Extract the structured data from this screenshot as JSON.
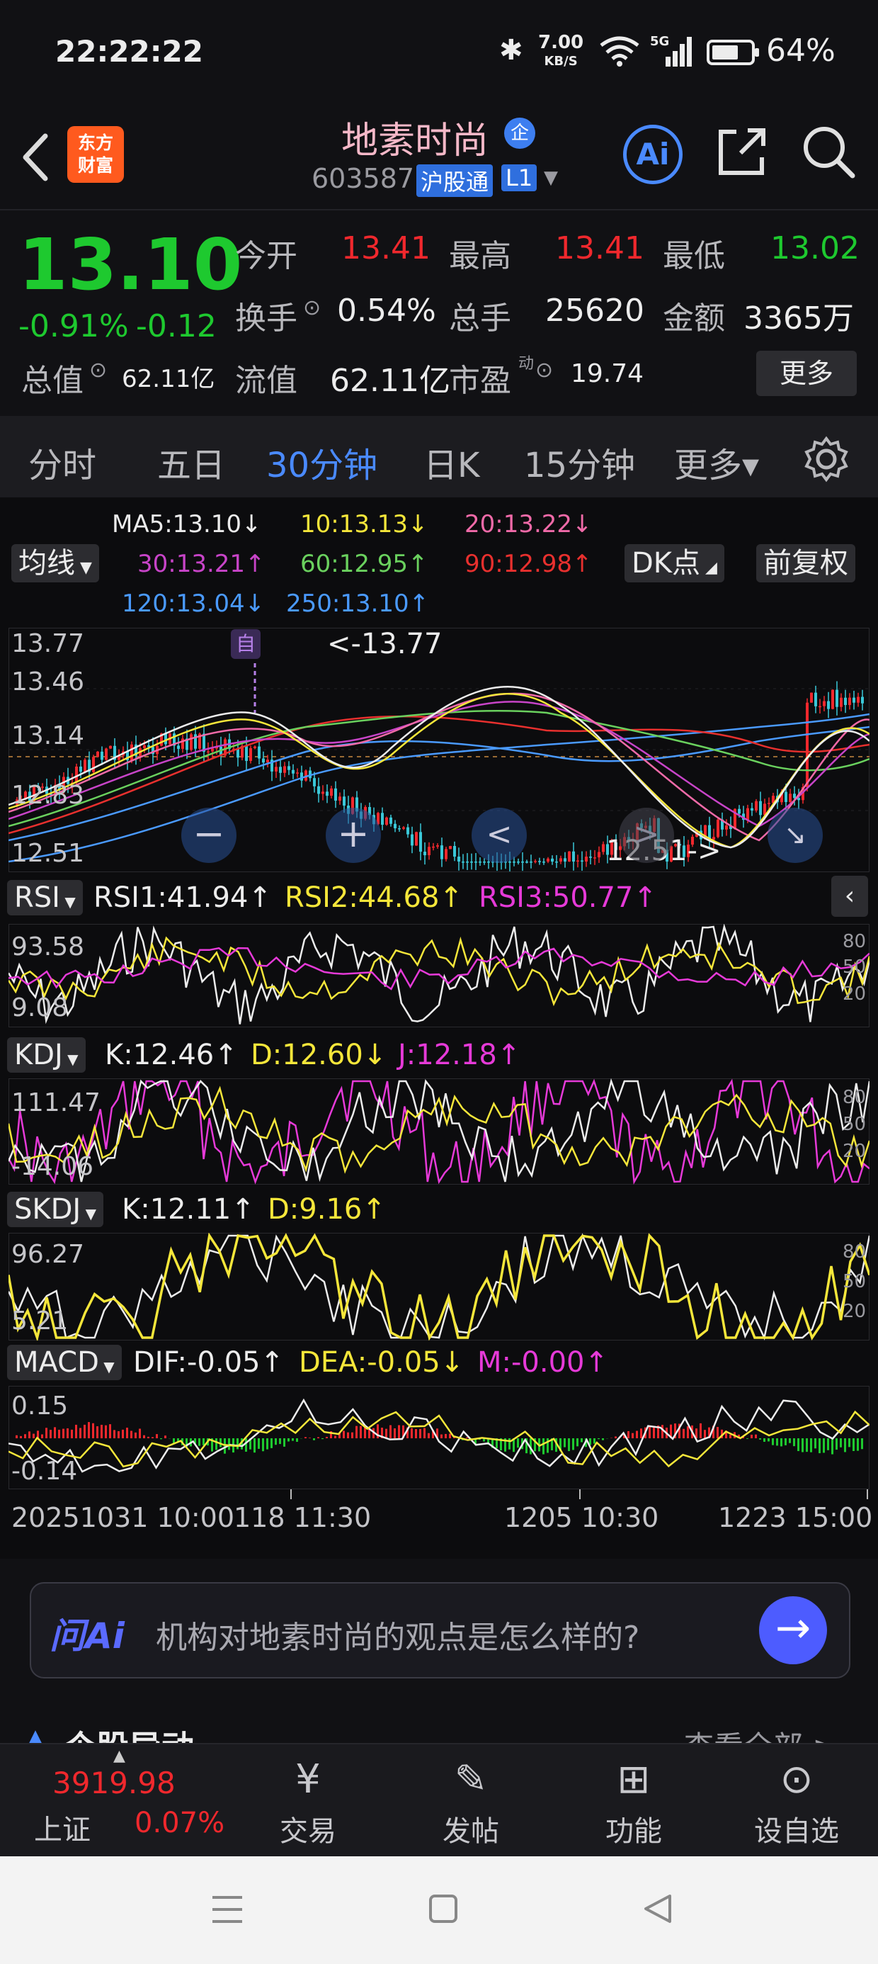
{
  "status_bar": {
    "time": "22:22:22",
    "net_speed_value": "7.00",
    "net_speed_unit": "KB/S",
    "signal_label": "5G",
    "battery_pct": "64%",
    "icons": [
      "bluetooth-icon",
      "wifi-icon",
      "signal-icon",
      "battery-icon"
    ]
  },
  "header": {
    "logo_line1": "东方",
    "logo_line2": "财富",
    "stock_name": "地素时尚",
    "badge": "企",
    "code": "603587",
    "connect_tag": "沪股通",
    "level_tag": "L1",
    "ai_label": "Ai"
  },
  "quote": {
    "price": "13.10",
    "change_pct": "-0.91%",
    "change_abs": "-0.12",
    "open_label": "今开",
    "open": "13.41",
    "high_label": "最高",
    "high": "13.41",
    "low_label": "最低",
    "low": "13.02",
    "turnover_label": "换手",
    "turnover": "0.54%",
    "volume_label": "总手",
    "volume": "25620",
    "amount_label": "金额",
    "amount": "3365万",
    "mktcap_label": "总值",
    "mktcap": "62.11亿",
    "float_label": "流值",
    "float": "62.11亿",
    "pe_label": "市盈",
    "pe_sup": "动",
    "pe": "19.74",
    "more_label": "更多"
  },
  "tabs": [
    {
      "label": "分时"
    },
    {
      "label": "五日"
    },
    {
      "label": "30分钟",
      "active": true
    },
    {
      "label": "日K"
    },
    {
      "label": "15分钟"
    },
    {
      "label": "更多▾"
    }
  ],
  "chart": {
    "ma_button": "均线",
    "dk_button": "DK点",
    "fq_button": "前复权",
    "ma_values": [
      {
        "text": "MA5:13.10↓",
        "color": "#ececec"
      },
      {
        "text": "10:13.13↓",
        "color": "#f5e63a"
      },
      {
        "text": "20:13.22↓",
        "color": "#f06aa8"
      },
      {
        "text": "30:13.21↑",
        "color": "#c844c8"
      },
      {
        "text": "60:12.95↑",
        "color": "#6ad15e"
      },
      {
        "text": "90:12.98↑",
        "color": "#e8302e"
      },
      {
        "text": "120:13.04↓",
        "color": "#4a9aff"
      },
      {
        "text": "250:13.10↑",
        "color": "#4a9aff"
      }
    ],
    "price_axis": [
      "13.77",
      "13.46",
      "13.14",
      "12.83",
      "12.51"
    ],
    "self_marker": "自",
    "high_marker": "<-13.77",
    "low_marker": "12.51->",
    "rsi": {
      "name": "RSI",
      "v1": "RSI1:41.94↑",
      "v2": "RSI2:44.68↑",
      "v3": "RSI3:50.77↑",
      "axis_top": "93.58",
      "axis_bottom": "9.08",
      "levels": [
        "80",
        "50",
        "20"
      ]
    },
    "kdj": {
      "name": "KDJ",
      "k": "K:12.46↑",
      "d": "D:12.60↓",
      "j": "J:12.18↑",
      "axis_top": "111.47",
      "axis_bottom": "-14.06",
      "levels": [
        "80",
        "50",
        "20"
      ]
    },
    "skdj": {
      "name": "SKDJ",
      "k": "K:12.11↑",
      "d": "D:9.16↑",
      "axis_top": "96.27",
      "axis_bottom": "5.21",
      "levels": [
        "80",
        "50",
        "20"
      ]
    },
    "macd": {
      "name": "MACD",
      "dif": "DIF:-0.05↑",
      "dea": "DEA:-0.05↓",
      "m": "M:-0.00↑",
      "axis_top": "0.15",
      "axis_bottom": "-0.14"
    },
    "x_axis": [
      "20251031 10:00",
      "118 11:30",
      "1205 10:30",
      "1223 15:00"
    ],
    "colors": {
      "up": "#f0282d",
      "down": "#1ec92f",
      "accent": "#4a8aff"
    }
  },
  "ai_box": {
    "brand": "问Ai",
    "prompt": "机构对地素时尚的观点是怎么样的?"
  },
  "section_peek": {
    "left": "个股异动",
    "right": "查看全部 >"
  },
  "bottom_nav": {
    "index_value": "3919.98",
    "index_name": "上证",
    "index_change": "0.07%",
    "items": [
      {
        "label": "交易",
        "icon": "trade-icon"
      },
      {
        "label": "发帖",
        "icon": "post-icon"
      },
      {
        "label": "功能",
        "icon": "apps-icon"
      },
      {
        "label": "设自选",
        "icon": "favorite-icon"
      }
    ]
  }
}
